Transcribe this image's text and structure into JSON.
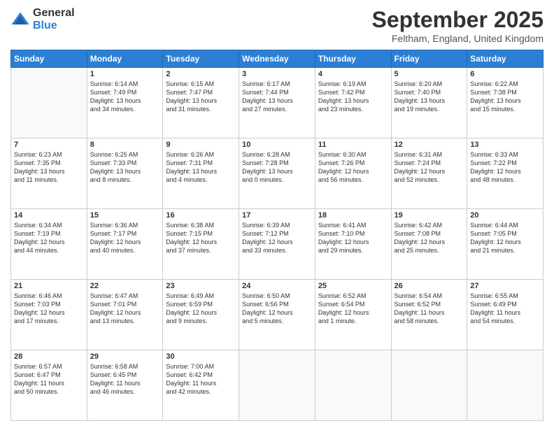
{
  "header": {
    "logo_general": "General",
    "logo_blue": "Blue",
    "title": "September 2025",
    "location": "Feltham, England, United Kingdom"
  },
  "weekdays": [
    "Sunday",
    "Monday",
    "Tuesday",
    "Wednesday",
    "Thursday",
    "Friday",
    "Saturday"
  ],
  "weeks": [
    [
      {
        "day": "",
        "info": ""
      },
      {
        "day": "1",
        "info": "Sunrise: 6:14 AM\nSunset: 7:49 PM\nDaylight: 13 hours\nand 34 minutes."
      },
      {
        "day": "2",
        "info": "Sunrise: 6:15 AM\nSunset: 7:47 PM\nDaylight: 13 hours\nand 31 minutes."
      },
      {
        "day": "3",
        "info": "Sunrise: 6:17 AM\nSunset: 7:44 PM\nDaylight: 13 hours\nand 27 minutes."
      },
      {
        "day": "4",
        "info": "Sunrise: 6:19 AM\nSunset: 7:42 PM\nDaylight: 13 hours\nand 23 minutes."
      },
      {
        "day": "5",
        "info": "Sunrise: 6:20 AM\nSunset: 7:40 PM\nDaylight: 13 hours\nand 19 minutes."
      },
      {
        "day": "6",
        "info": "Sunrise: 6:22 AM\nSunset: 7:38 PM\nDaylight: 13 hours\nand 15 minutes."
      }
    ],
    [
      {
        "day": "7",
        "info": "Sunrise: 6:23 AM\nSunset: 7:35 PM\nDaylight: 13 hours\nand 11 minutes."
      },
      {
        "day": "8",
        "info": "Sunrise: 6:25 AM\nSunset: 7:33 PM\nDaylight: 13 hours\nand 8 minutes."
      },
      {
        "day": "9",
        "info": "Sunrise: 6:26 AM\nSunset: 7:31 PM\nDaylight: 13 hours\nand 4 minutes."
      },
      {
        "day": "10",
        "info": "Sunrise: 6:28 AM\nSunset: 7:28 PM\nDaylight: 13 hours\nand 0 minutes."
      },
      {
        "day": "11",
        "info": "Sunrise: 6:30 AM\nSunset: 7:26 PM\nDaylight: 12 hours\nand 56 minutes."
      },
      {
        "day": "12",
        "info": "Sunrise: 6:31 AM\nSunset: 7:24 PM\nDaylight: 12 hours\nand 52 minutes."
      },
      {
        "day": "13",
        "info": "Sunrise: 6:33 AM\nSunset: 7:22 PM\nDaylight: 12 hours\nand 48 minutes."
      }
    ],
    [
      {
        "day": "14",
        "info": "Sunrise: 6:34 AM\nSunset: 7:19 PM\nDaylight: 12 hours\nand 44 minutes."
      },
      {
        "day": "15",
        "info": "Sunrise: 6:36 AM\nSunset: 7:17 PM\nDaylight: 12 hours\nand 40 minutes."
      },
      {
        "day": "16",
        "info": "Sunrise: 6:38 AM\nSunset: 7:15 PM\nDaylight: 12 hours\nand 37 minutes."
      },
      {
        "day": "17",
        "info": "Sunrise: 6:39 AM\nSunset: 7:12 PM\nDaylight: 12 hours\nand 33 minutes."
      },
      {
        "day": "18",
        "info": "Sunrise: 6:41 AM\nSunset: 7:10 PM\nDaylight: 12 hours\nand 29 minutes."
      },
      {
        "day": "19",
        "info": "Sunrise: 6:42 AM\nSunset: 7:08 PM\nDaylight: 12 hours\nand 25 minutes."
      },
      {
        "day": "20",
        "info": "Sunrise: 6:44 AM\nSunset: 7:05 PM\nDaylight: 12 hours\nand 21 minutes."
      }
    ],
    [
      {
        "day": "21",
        "info": "Sunrise: 6:46 AM\nSunset: 7:03 PM\nDaylight: 12 hours\nand 17 minutes."
      },
      {
        "day": "22",
        "info": "Sunrise: 6:47 AM\nSunset: 7:01 PM\nDaylight: 12 hours\nand 13 minutes."
      },
      {
        "day": "23",
        "info": "Sunrise: 6:49 AM\nSunset: 6:59 PM\nDaylight: 12 hours\nand 9 minutes."
      },
      {
        "day": "24",
        "info": "Sunrise: 6:50 AM\nSunset: 6:56 PM\nDaylight: 12 hours\nand 5 minutes."
      },
      {
        "day": "25",
        "info": "Sunrise: 6:52 AM\nSunset: 6:54 PM\nDaylight: 12 hours\nand 1 minute."
      },
      {
        "day": "26",
        "info": "Sunrise: 6:54 AM\nSunset: 6:52 PM\nDaylight: 11 hours\nand 58 minutes."
      },
      {
        "day": "27",
        "info": "Sunrise: 6:55 AM\nSunset: 6:49 PM\nDaylight: 11 hours\nand 54 minutes."
      }
    ],
    [
      {
        "day": "28",
        "info": "Sunrise: 6:57 AM\nSunset: 6:47 PM\nDaylight: 11 hours\nand 50 minutes."
      },
      {
        "day": "29",
        "info": "Sunrise: 6:58 AM\nSunset: 6:45 PM\nDaylight: 11 hours\nand 46 minutes."
      },
      {
        "day": "30",
        "info": "Sunrise: 7:00 AM\nSunset: 6:42 PM\nDaylight: 11 hours\nand 42 minutes."
      },
      {
        "day": "",
        "info": ""
      },
      {
        "day": "",
        "info": ""
      },
      {
        "day": "",
        "info": ""
      },
      {
        "day": "",
        "info": ""
      }
    ]
  ]
}
